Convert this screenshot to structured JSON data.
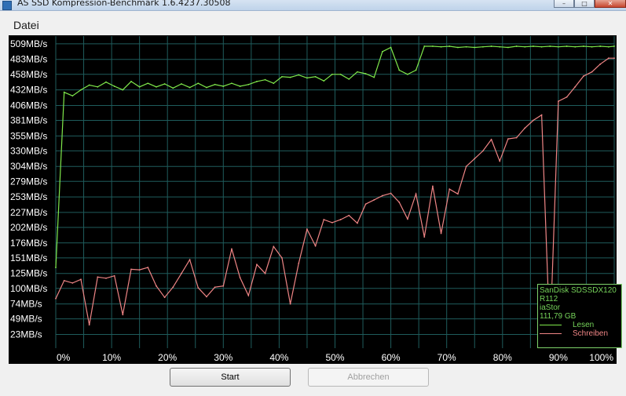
{
  "window": {
    "title": "AS SSD Kompression-Benchmark 1.6.4237.30508",
    "minimize": "–",
    "maximize": "□",
    "close": "✕"
  },
  "section": "Datei",
  "legend": {
    "device": "SanDisk SDSSDX120",
    "firmware": "R112",
    "driver": "iaStor",
    "capacity": "111,79 GB",
    "read_label": "Lesen",
    "write_label": "Schreiben"
  },
  "buttons": {
    "start": "Start",
    "cancel": "Abbrechen"
  },
  "colors": {
    "background": "#000000",
    "grid": "#1f5c5c",
    "read": "#7fe84b",
    "write": "#ef8585",
    "axis_text": "#ffffff"
  },
  "chart_data": {
    "type": "line",
    "xlabel": "",
    "ylabel": "",
    "x_ticks": [
      "0%",
      "10%",
      "20%",
      "30%",
      "40%",
      "50%",
      "60%",
      "70%",
      "80%",
      "90%",
      "100%"
    ],
    "y_ticks": [
      "509MB/s",
      "483MB/s",
      "458MB/s",
      "432MB/s",
      "406MB/s",
      "381MB/s",
      "355MB/s",
      "330MB/s",
      "304MB/s",
      "279MB/s",
      "253MB/s",
      "227MB/s",
      "202MB/s",
      "176MB/s",
      "151MB/s",
      "125MB/s",
      "100MB/s",
      "74MB/s",
      "49MB/s",
      "23MB/s"
    ],
    "xlim": [
      0,
      100
    ],
    "ylim": [
      0,
      522
    ],
    "grid": true,
    "legend_position": "bottom-right",
    "series": [
      {
        "name": "Lesen",
        "color": "#7fe84b",
        "x": [
          0,
          1.5,
          3,
          4.5,
          6,
          7.5,
          9,
          10.5,
          12,
          13.5,
          15,
          16.5,
          18,
          19.5,
          21,
          22.5,
          24,
          25.5,
          27,
          28.5,
          30,
          31.5,
          33,
          34.5,
          36,
          37.5,
          39,
          40.5,
          42,
          43.5,
          45,
          46.5,
          48,
          49.5,
          51,
          52.5,
          54,
          55.5,
          57,
          58.5,
          60,
          61.5,
          63,
          64.5,
          66,
          67.5,
          69,
          70.5,
          72,
          73.5,
          75,
          76.5,
          78,
          79.5,
          81,
          82.5,
          84,
          85.5,
          87,
          88.5,
          90,
          91.5,
          93,
          94.5,
          96,
          97.5,
          99,
          100
        ],
        "values": [
          135,
          428,
          422,
          432,
          440,
          437,
          445,
          438,
          432,
          446,
          437,
          443,
          437,
          442,
          435,
          442,
          436,
          443,
          436,
          441,
          438,
          443,
          438,
          441,
          446,
          449,
          443,
          454,
          453,
          457,
          452,
          454,
          447,
          458,
          458,
          450,
          462,
          459,
          453,
          496,
          503,
          465,
          458,
          465,
          505,
          505,
          504,
          505,
          503,
          504,
          503,
          504,
          505,
          504,
          503,
          505,
          504,
          505,
          504,
          505,
          504,
          505,
          504,
          505,
          504,
          505,
          504,
          505
        ]
      },
      {
        "name": "Schreiben",
        "color": "#ef8585",
        "x": [
          0,
          1.5,
          3,
          4.5,
          6,
          7.5,
          9,
          10.5,
          12,
          13.5,
          15,
          16.5,
          18,
          19.5,
          21,
          22.5,
          24,
          25.5,
          27,
          28.5,
          30,
          31.5,
          33,
          34.5,
          36,
          37.5,
          39,
          40.5,
          42,
          43.5,
          45,
          46.5,
          48,
          49.5,
          51,
          52.5,
          54,
          55.5,
          57,
          58.5,
          60,
          61.5,
          63,
          64.5,
          66,
          67.5,
          69,
          70.5,
          72,
          73.5,
          75,
          76.5,
          78,
          79.5,
          81,
          82.5,
          84,
          85.5,
          87,
          88.5,
          90,
          91.5,
          93,
          94.5,
          96,
          97.5,
          99,
          100
        ],
        "values": [
          83,
          113,
          109,
          115,
          39,
          119,
          117,
          121,
          56,
          132,
          131,
          135,
          104,
          85,
          102,
          125,
          148,
          101,
          86,
          102,
          104,
          166,
          118,
          88,
          140,
          125,
          170,
          151,
          74,
          142,
          199,
          171,
          215,
          210,
          215,
          222,
          209,
          241,
          248,
          255,
          259,
          244,
          216,
          258,
          186,
          271,
          192,
          266,
          258,
          304,
          317,
          330,
          349,
          313,
          350,
          352,
          368,
          381,
          390,
          12,
          413,
          420,
          437,
          455,
          462,
          475,
          485,
          485
        ]
      }
    ]
  }
}
